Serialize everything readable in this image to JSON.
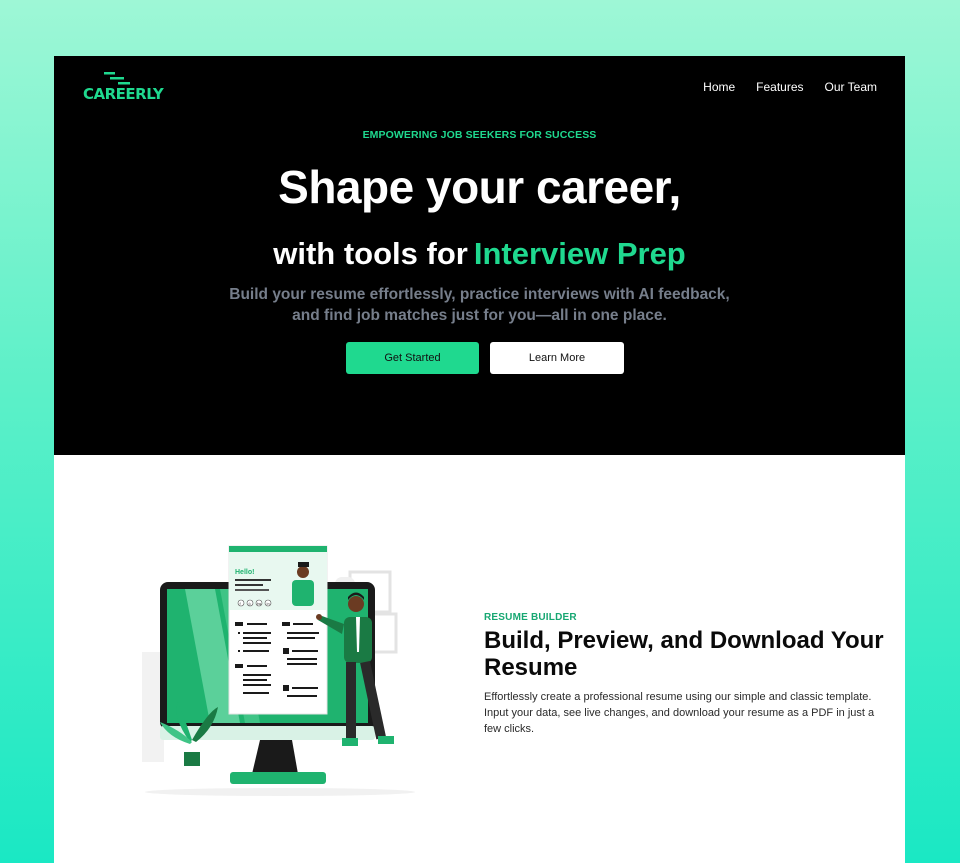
{
  "brand": {
    "name": "CAREERLY",
    "accent": "#1fd98f"
  },
  "nav": {
    "items": [
      "Home",
      "Features",
      "Our Team"
    ]
  },
  "hero": {
    "eyebrow": "EMPOWERING JOB SEEKERS FOR SUCCESS",
    "title": "Shape your career,",
    "subtitle_prefix": "with tools for",
    "subtitle_accent": "Interview Prep",
    "description": "Build your resume effortlessly, practice interviews with AI feedback, and find job matches just for you—all in one place.",
    "primary_button": "Get Started",
    "secondary_button": "Learn More"
  },
  "feature": {
    "eyebrow": "RESUME BUILDER",
    "title": "Build, Preview, and Download Your Resume",
    "description": "Effortlessly create a professional resume using our simple and classic template. Input your data, see live changes, and download your resume as a PDF in just a few clicks.",
    "illustration": {
      "greeting": "Hello!",
      "social_icons": [
        "f",
        "◎",
        "in",
        "tw"
      ]
    }
  }
}
